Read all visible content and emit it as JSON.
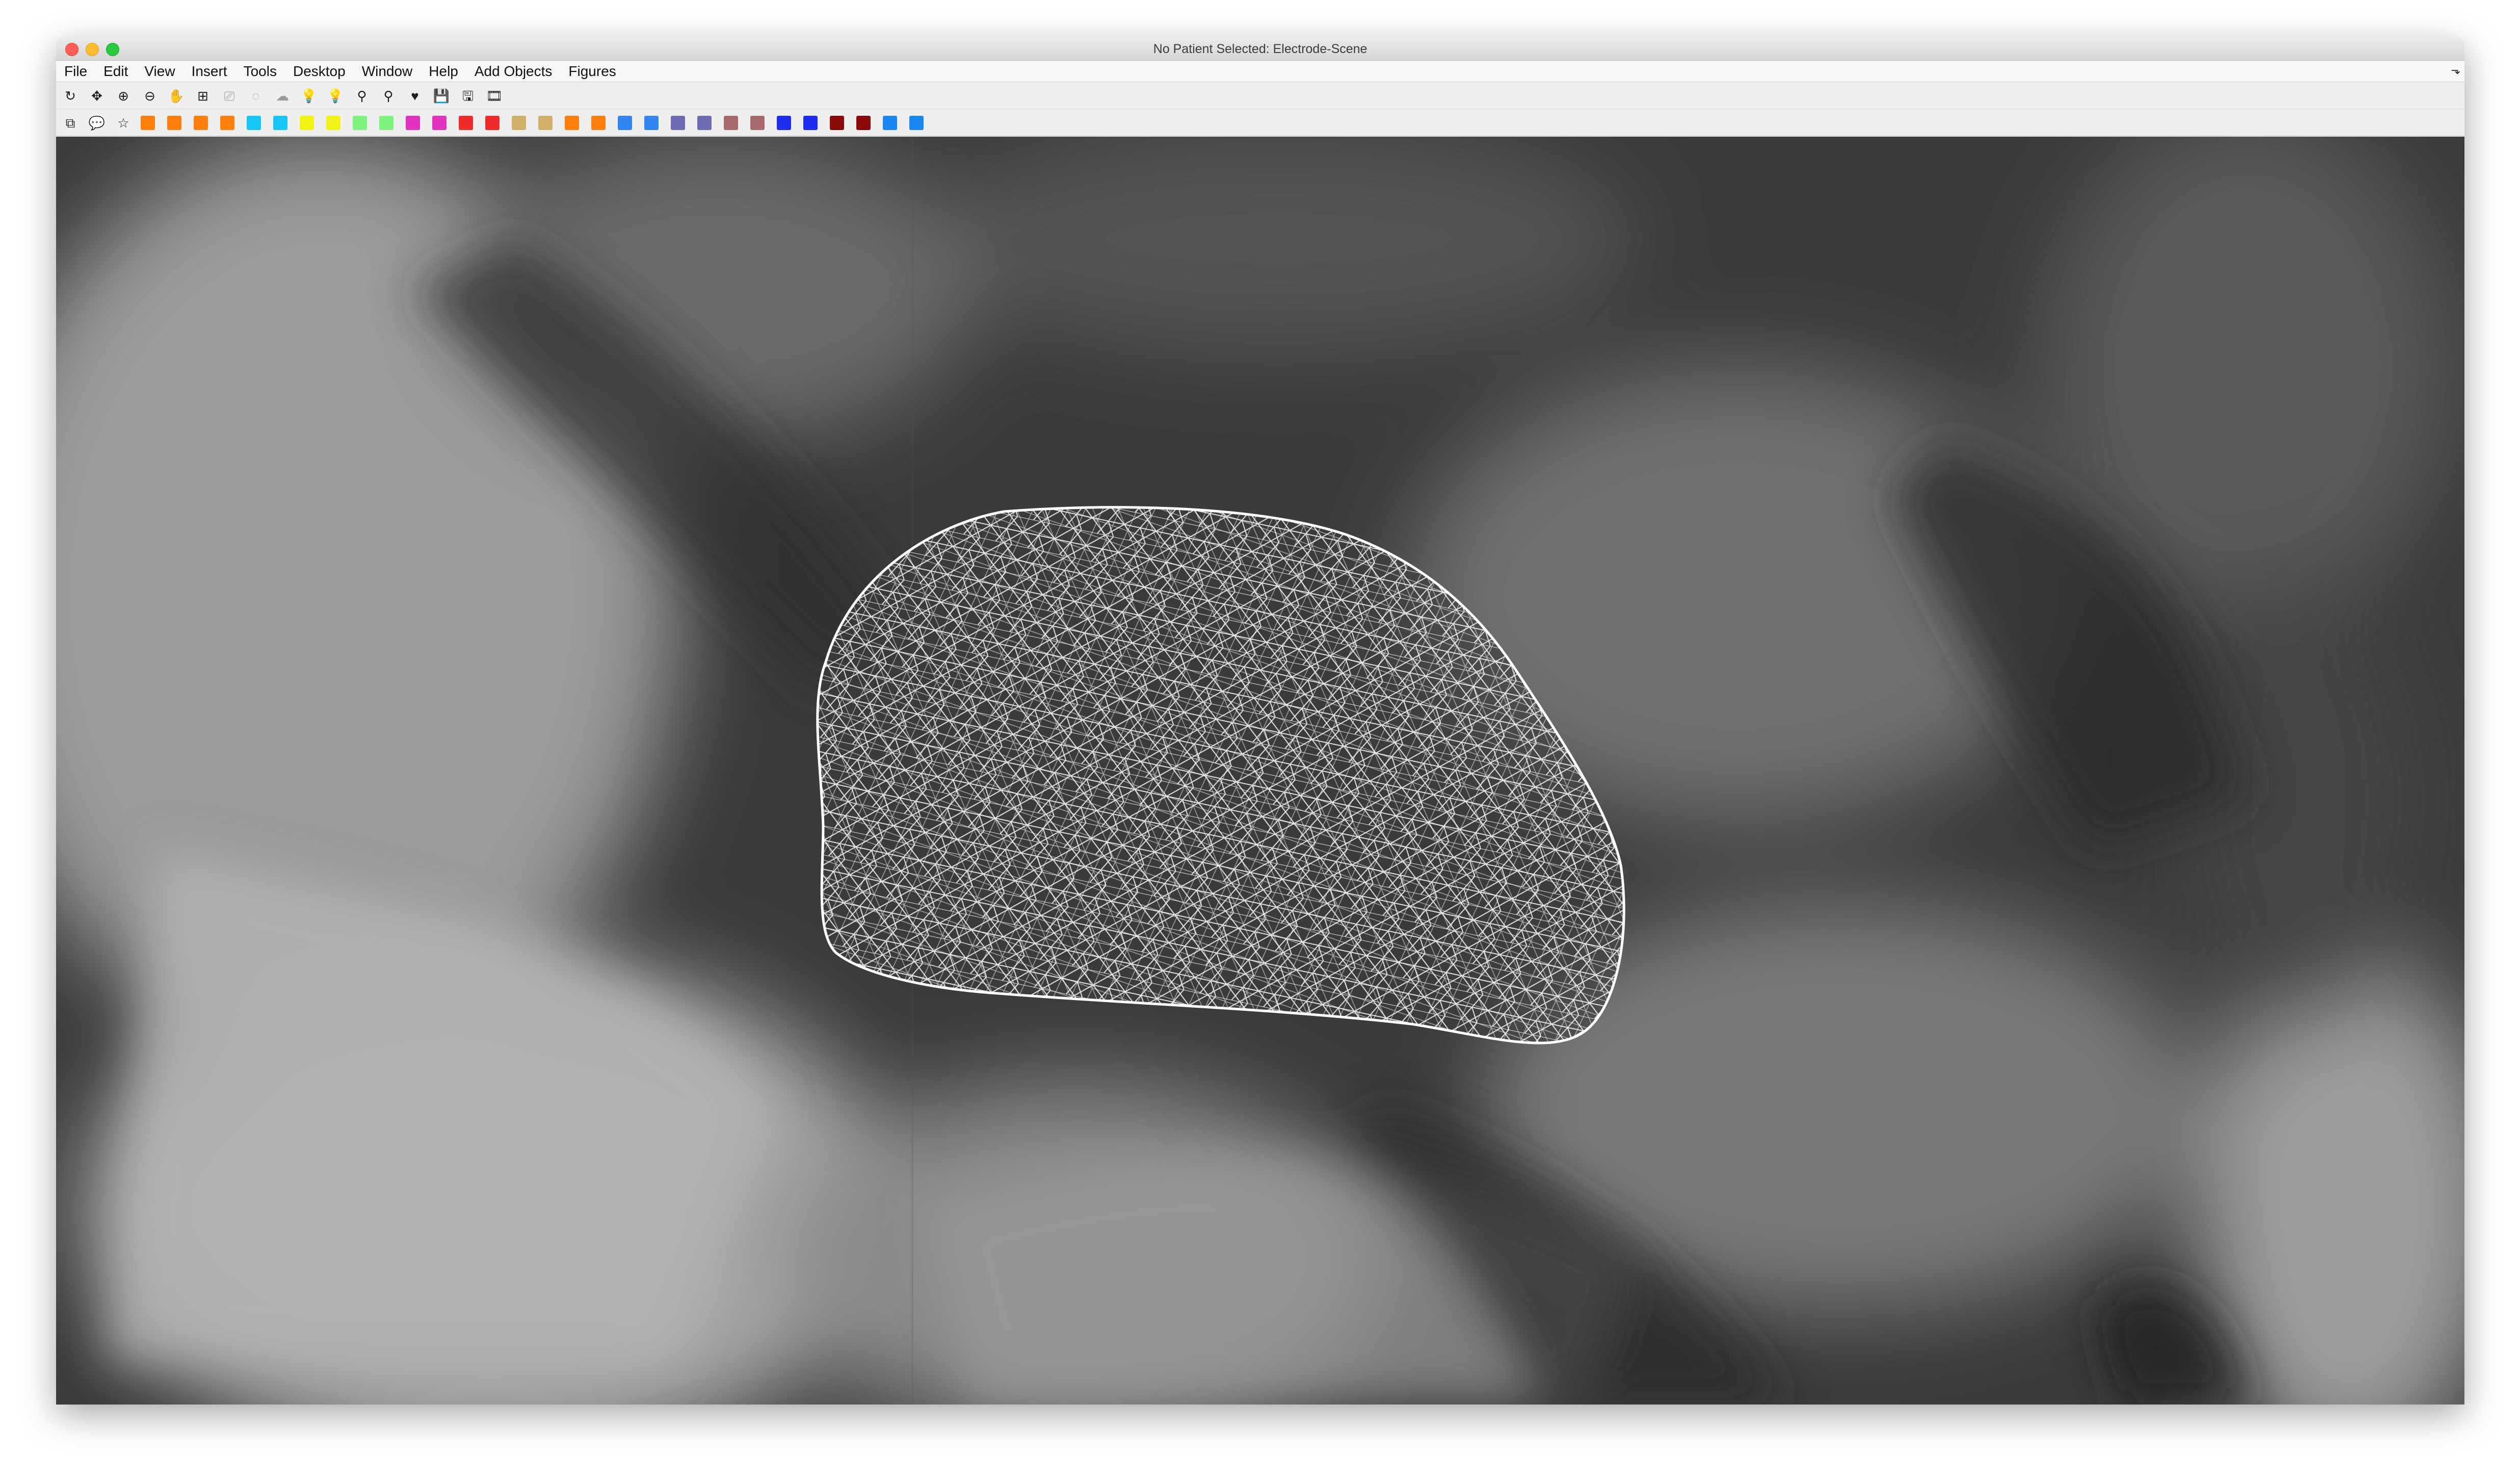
{
  "window": {
    "title": "No Patient Selected: Electrode-Scene"
  },
  "menubar": {
    "items": [
      "File",
      "Edit",
      "View",
      "Insert",
      "Tools",
      "Desktop",
      "Window",
      "Help",
      "Add Objects",
      "Figures"
    ],
    "corner_glyph": "⬎"
  },
  "toolbar1": {
    "icons": [
      {
        "name": "rotate-3d-icon",
        "glyph": "↻"
      },
      {
        "name": "pan-icon",
        "glyph": "✥"
      },
      {
        "name": "zoom-in-icon",
        "glyph": "⊕"
      },
      {
        "name": "zoom-out-icon",
        "glyph": "⊖"
      },
      {
        "name": "hand-icon",
        "glyph": "✋"
      },
      {
        "name": "data-cursor-icon",
        "glyph": "⊞"
      },
      {
        "name": "brush-icon",
        "glyph": "⎚"
      },
      {
        "name": "lasso-select-icon",
        "glyph": "◌"
      },
      {
        "name": "brain-icon",
        "glyph": "☁"
      },
      {
        "name": "light-icon",
        "glyph": "💡"
      },
      {
        "name": "light-on-icon",
        "glyph": "💡"
      },
      {
        "name": "light-off-icon",
        "glyph": "⚲"
      },
      {
        "name": "light-remove-icon",
        "glyph": "⚲"
      },
      {
        "name": "heart-icon",
        "glyph": "♥"
      },
      {
        "name": "save-icon",
        "glyph": "💾"
      },
      {
        "name": "save-as-icon",
        "glyph": "🖫"
      },
      {
        "name": "film-icon",
        "glyph": "🎞"
      }
    ]
  },
  "toolbar2": {
    "icons": [
      {
        "name": "layers-icon",
        "glyph": "⧉"
      },
      {
        "name": "chat-icon",
        "glyph": "💬"
      },
      {
        "name": "star-icon",
        "glyph": "☆"
      }
    ],
    "swatch_colors": [
      "#ff7f0e",
      "#ff7f0e",
      "#ff7f0e",
      "#ff7f0e",
      "#17c6f5",
      "#17c6f5",
      "#f2f216",
      "#f2f216",
      "#7df27d",
      "#7df27d",
      "#e233c0",
      "#e233c0",
      "#ef2b2b",
      "#ef2b2b",
      "#d2b06a",
      "#d2b06a",
      "#ff7f0e",
      "#ff7f0e",
      "#3385f0",
      "#3385f0",
      "#6d6bb2",
      "#6d6bb2",
      "#a66a6a",
      "#a66a6a",
      "#1e2ef0",
      "#1e2ef0",
      "#8b0a0a",
      "#8b0a0a",
      "#1a86f0",
      "#1a86f0"
    ]
  }
}
